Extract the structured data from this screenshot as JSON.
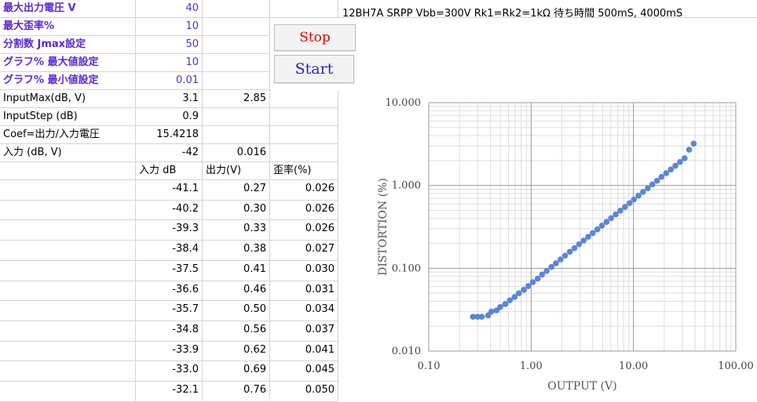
{
  "params": [
    {
      "label": "最大出力電圧 V",
      "value": "40"
    },
    {
      "label": "最大歪率%",
      "value": "10"
    },
    {
      "label": "分割数 Jmax設定",
      "value": "50"
    },
    {
      "label": "グラフ% 最大値設定",
      "value": "10"
    },
    {
      "label": "グラフ% 最小値設定",
      "value": "0.01"
    }
  ],
  "calc": [
    {
      "label": "InputMax(dB, V)",
      "v1": "3.1",
      "v2": "2.85"
    },
    {
      "label": "InputStep (dB)",
      "v1": "0.9",
      "v2": ""
    },
    {
      "label": "Coef=出力/入力電圧",
      "v1": "15.4218",
      "v2": ""
    },
    {
      "label": "入力 (dB, V)",
      "v1": "-42",
      "v2": "0.016"
    }
  ],
  "table": {
    "headers": [
      "入力 dB",
      "出力(V)",
      "歪率(%)"
    ],
    "rows": [
      [
        "-41.1",
        "0.27",
        "0.026"
      ],
      [
        "-40.2",
        "0.30",
        "0.026"
      ],
      [
        "-39.3",
        "0.33",
        "0.026"
      ],
      [
        "-38.4",
        "0.38",
        "0.027"
      ],
      [
        "-37.5",
        "0.41",
        "0.030"
      ],
      [
        "-36.6",
        "0.46",
        "0.031"
      ],
      [
        "-35.7",
        "0.50",
        "0.034"
      ],
      [
        "-34.8",
        "0.56",
        "0.037"
      ],
      [
        "-33.9",
        "0.62",
        "0.041"
      ],
      [
        "-33.0",
        "0.69",
        "0.045"
      ],
      [
        "-32.1",
        "0.76",
        "0.050"
      ]
    ]
  },
  "buttons": {
    "stop": "Stop",
    "start": "Start"
  },
  "colors": {
    "param_text": "#5a2ad6",
    "stop": "#e00000",
    "start": "#2a22cc",
    "series": "#5b85d6"
  },
  "chart_data": {
    "type": "scatter",
    "title": "12BH7A SRPP Vbb=300V Rk1=Rk2=1kΩ 待ち時間 500mS, 4000mS",
    "xlabel": "OUTPUT (V)",
    "ylabel": "DISTORTION (%)",
    "x_scale": "log",
    "y_scale": "log",
    "xlim": [
      0.1,
      100
    ],
    "ylim": [
      0.01,
      10
    ],
    "x_ticks": [
      "0.10",
      "1.00",
      "10.00",
      "100.00"
    ],
    "y_ticks": [
      "0.010",
      "0.100",
      "1.000",
      "10.000"
    ],
    "grid": true,
    "series": [
      {
        "x": [
          0.27,
          0.3,
          0.33,
          0.38,
          0.41,
          0.46,
          0.5,
          0.56,
          0.62,
          0.69,
          0.76,
          0.85,
          0.94,
          1.04,
          1.16,
          1.28,
          1.42,
          1.58,
          1.75,
          1.94,
          2.15,
          2.39,
          2.65,
          2.94,
          3.26,
          3.61,
          4.0,
          4.44,
          4.92,
          5.46,
          6.05,
          6.71,
          7.44,
          8.25,
          9.15,
          10.1,
          11.2,
          12.4,
          13.8,
          15.3,
          17.0,
          18.8,
          20.9,
          23.2,
          25.7,
          28.5,
          31.6,
          35.0,
          38.8
        ],
        "y": [
          0.026,
          0.026,
          0.026,
          0.027,
          0.03,
          0.031,
          0.034,
          0.037,
          0.041,
          0.045,
          0.05,
          0.055,
          0.061,
          0.068,
          0.075,
          0.084,
          0.093,
          0.104,
          0.115,
          0.128,
          0.142,
          0.158,
          0.175,
          0.195,
          0.216,
          0.24,
          0.266,
          0.295,
          0.327,
          0.363,
          0.403,
          0.447,
          0.496,
          0.551,
          0.611,
          0.678,
          0.753,
          0.835,
          0.927,
          1.03,
          1.14,
          1.27,
          1.41,
          1.56,
          1.73,
          1.92,
          2.13,
          2.7,
          3.2
        ]
      }
    ]
  }
}
